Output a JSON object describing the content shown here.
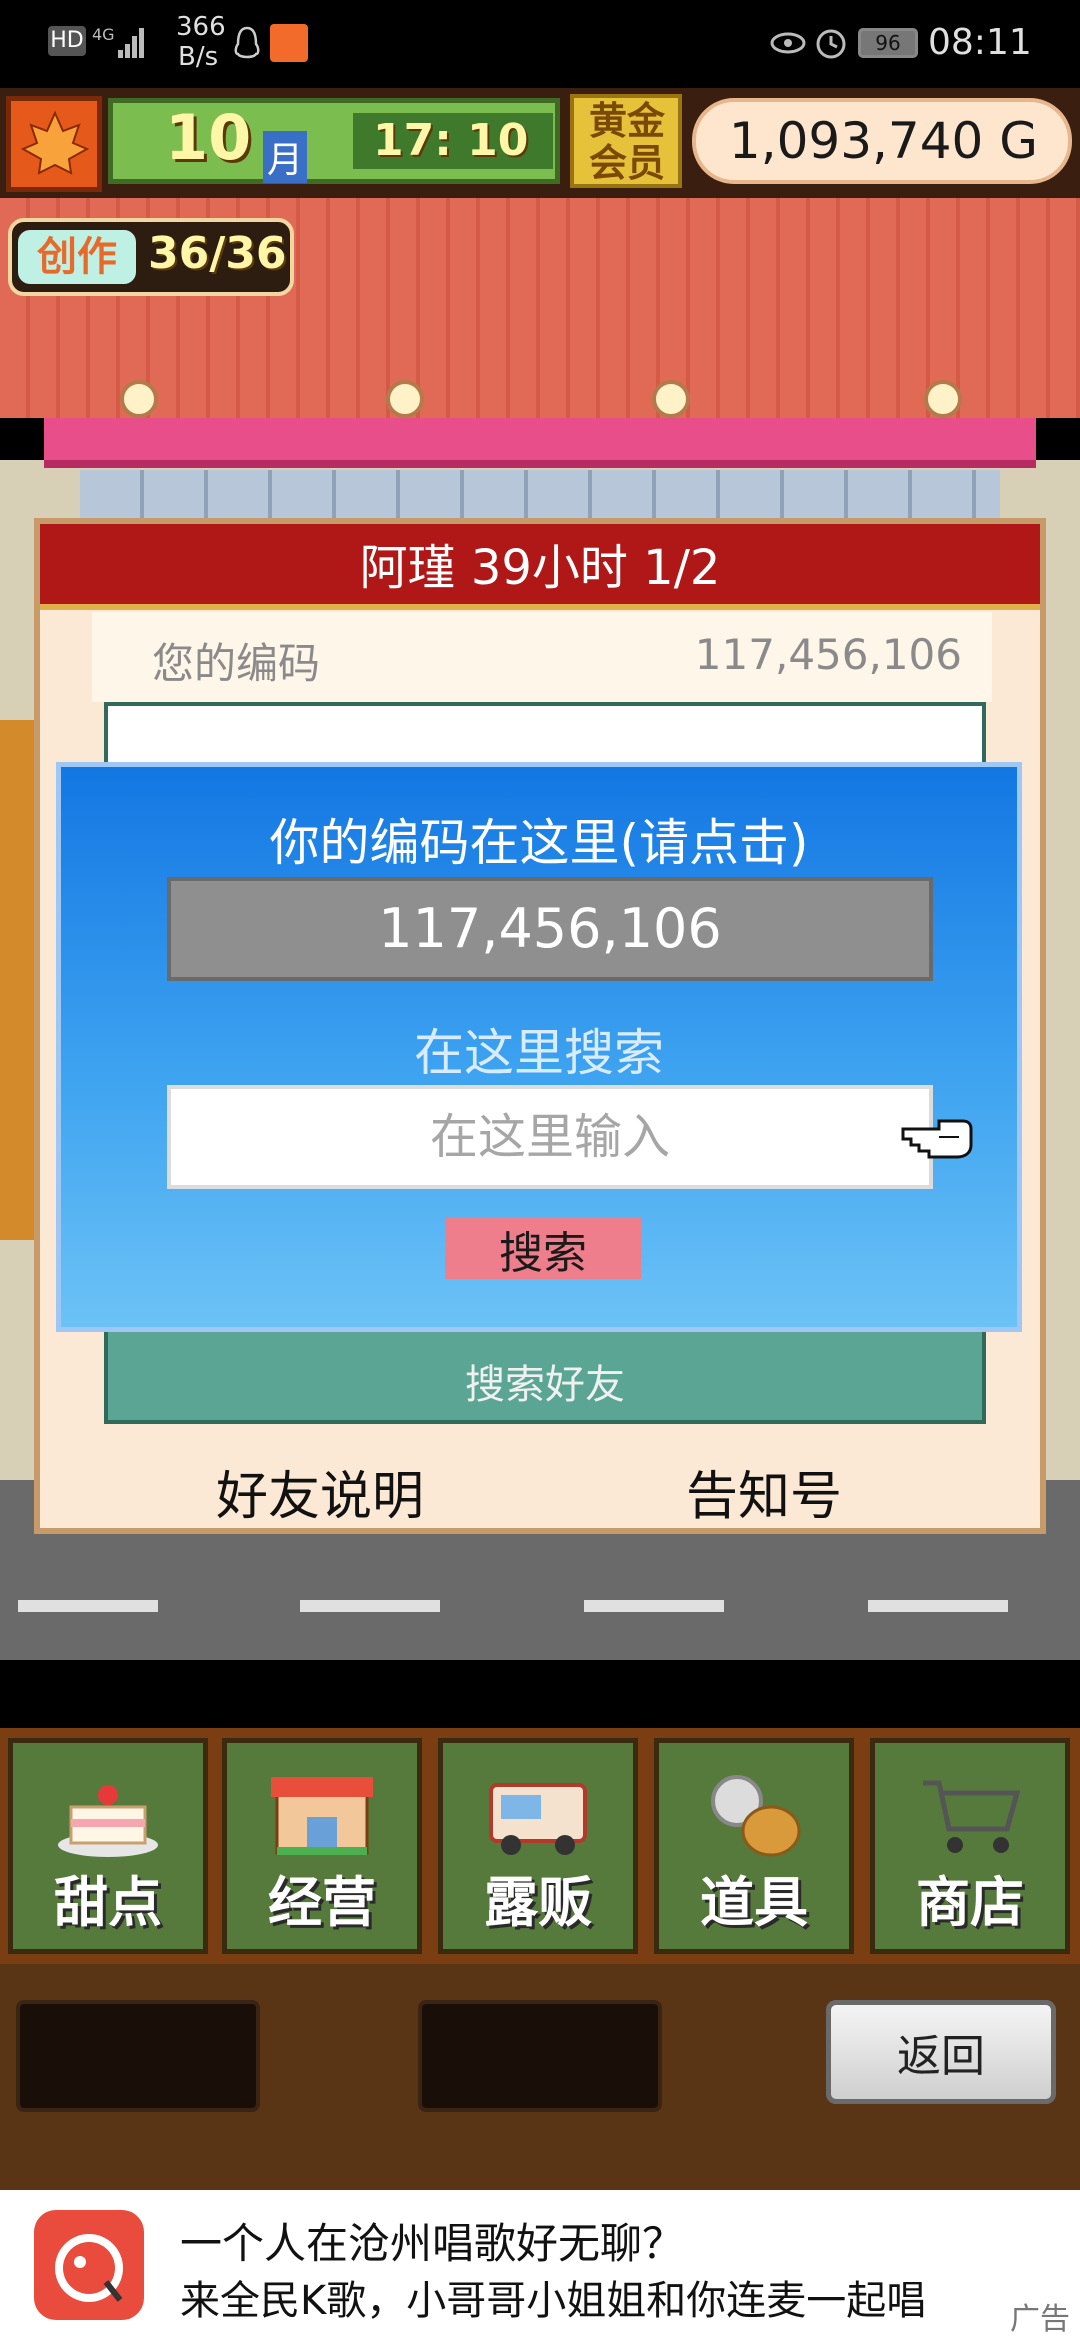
{
  "status_bar": {
    "network_speed": "366",
    "speed_unit": "B/s",
    "battery": "96",
    "time": "08:11"
  },
  "hud": {
    "month_num": "10",
    "month_unit": "月",
    "game_time": "17: 10",
    "vip_label": "黄金会员",
    "gold": "1,093,740 G",
    "create_label": "创作",
    "create_value": "36/36"
  },
  "friend_panel": {
    "title": "阿瑾  39小时 1/2",
    "code_label": "您的编码",
    "code_value": "117,456,106",
    "search_friend_label": "搜索好友",
    "help_label": "好友说明",
    "notice_label": "告知号"
  },
  "search_modal": {
    "title": "你的编码在这里(请点击)",
    "code_value": "117,456,106",
    "search_title": "在这里搜索",
    "search_placeholder": "在这里输入",
    "search_button": "搜索"
  },
  "menu": {
    "items": [
      {
        "label": "甜点",
        "icon": "cake-icon"
      },
      {
        "label": "经营",
        "icon": "shop-icon"
      },
      {
        "label": "露贩",
        "icon": "food-truck-icon"
      },
      {
        "label": "道具",
        "icon": "items-icon"
      },
      {
        "label": "商店",
        "icon": "cart-icon"
      }
    ],
    "back_label": "返回"
  },
  "ad": {
    "line1": "一个人在沧州唱歌好无聊？",
    "line2": "来全民K歌，小哥哥小姐姐和你连麦一起唱",
    "tag": "广告"
  },
  "colors": {
    "modal_blue": "#1377e3",
    "panel_header_red": "#b01818",
    "menu_green": "#557a3c",
    "search_button_pink": "#ef7e8c"
  }
}
